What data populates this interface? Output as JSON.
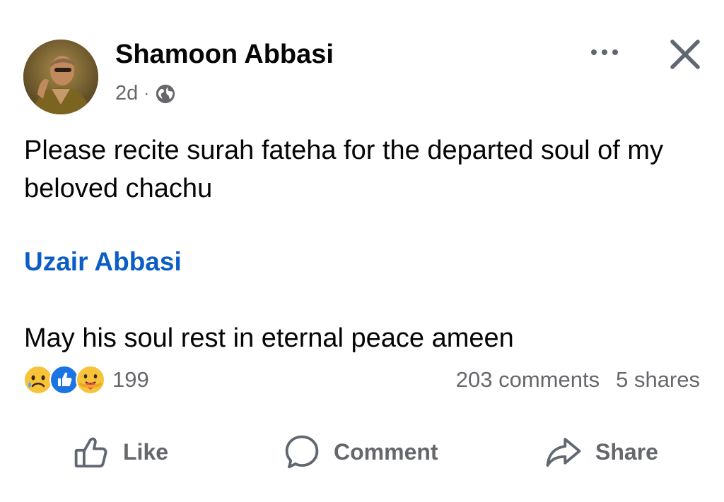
{
  "post": {
    "author": "Shamoon Abbasi",
    "time": "2d",
    "separator": "·",
    "privacy_icon": "globe-icon",
    "text": "Please recite surah fateha for the departed soul of my beloved chachu",
    "mention": "Uzair Abbasi",
    "text_2": "May his soul rest in eternal peace ameen"
  },
  "header": {
    "more_icon": "more-horizontal-icon",
    "close_icon": "close-icon"
  },
  "reactions": {
    "icons": [
      "sad-icon",
      "like-icon",
      "care-icon"
    ],
    "count": "199"
  },
  "stats": {
    "comments": "203 comments",
    "shares": "5 shares"
  },
  "actions": {
    "like": "Like",
    "comment": "Comment",
    "share": "Share"
  },
  "colors": {
    "link": "#0a5ec3",
    "secondary_text": "#65676b",
    "like_blue": "#1b74e4"
  }
}
